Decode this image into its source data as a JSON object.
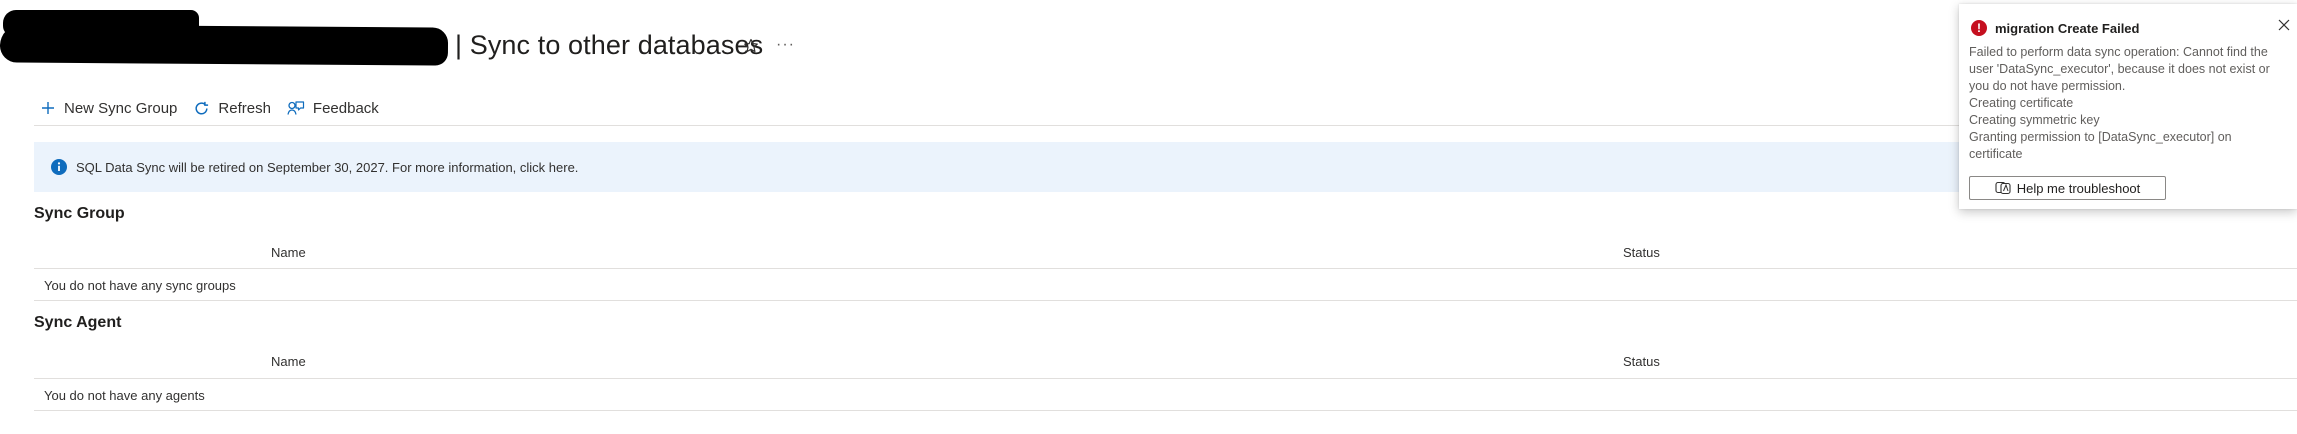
{
  "header": {
    "title": "| Sync to other databases",
    "more_label": "···"
  },
  "toolbar": {
    "new_sync_group_label": "New Sync Group",
    "refresh_label": "Refresh",
    "feedback_label": "Feedback"
  },
  "banner": {
    "text": "SQL Data Sync will be retired on September 30, 2027. For more information, click here."
  },
  "sync_group": {
    "title": "Sync Group",
    "columns": [
      "Name",
      "Status"
    ],
    "empty_text": "You do not have any sync groups"
  },
  "sync_agent": {
    "title": "Sync Agent",
    "columns": [
      "Name",
      "Status"
    ],
    "empty_text": "You do not have any agents"
  },
  "notification": {
    "title": "migration Create Failed",
    "error_glyph": "!",
    "body_lines": [
      "Failed to perform data sync operation: Cannot find the user 'DataSync_executor', because it does not exist or you do not have permission.",
      "Creating certificate",
      "Creating symmetric key",
      "Granting permission to [DataSync_executor] on certificate"
    ],
    "button_label": "Help me troubleshoot"
  },
  "colors": {
    "accent": "#0f6cbd",
    "error": "#c50f1f",
    "banner_bg": "#ebf3fc"
  },
  "icons": {
    "star": "star-icon",
    "plus": "plus-icon",
    "refresh": "refresh-icon",
    "feedback": "feedback-icon",
    "info": "info-icon",
    "close": "close-icon",
    "troubleshoot": "troubleshoot-icon"
  }
}
